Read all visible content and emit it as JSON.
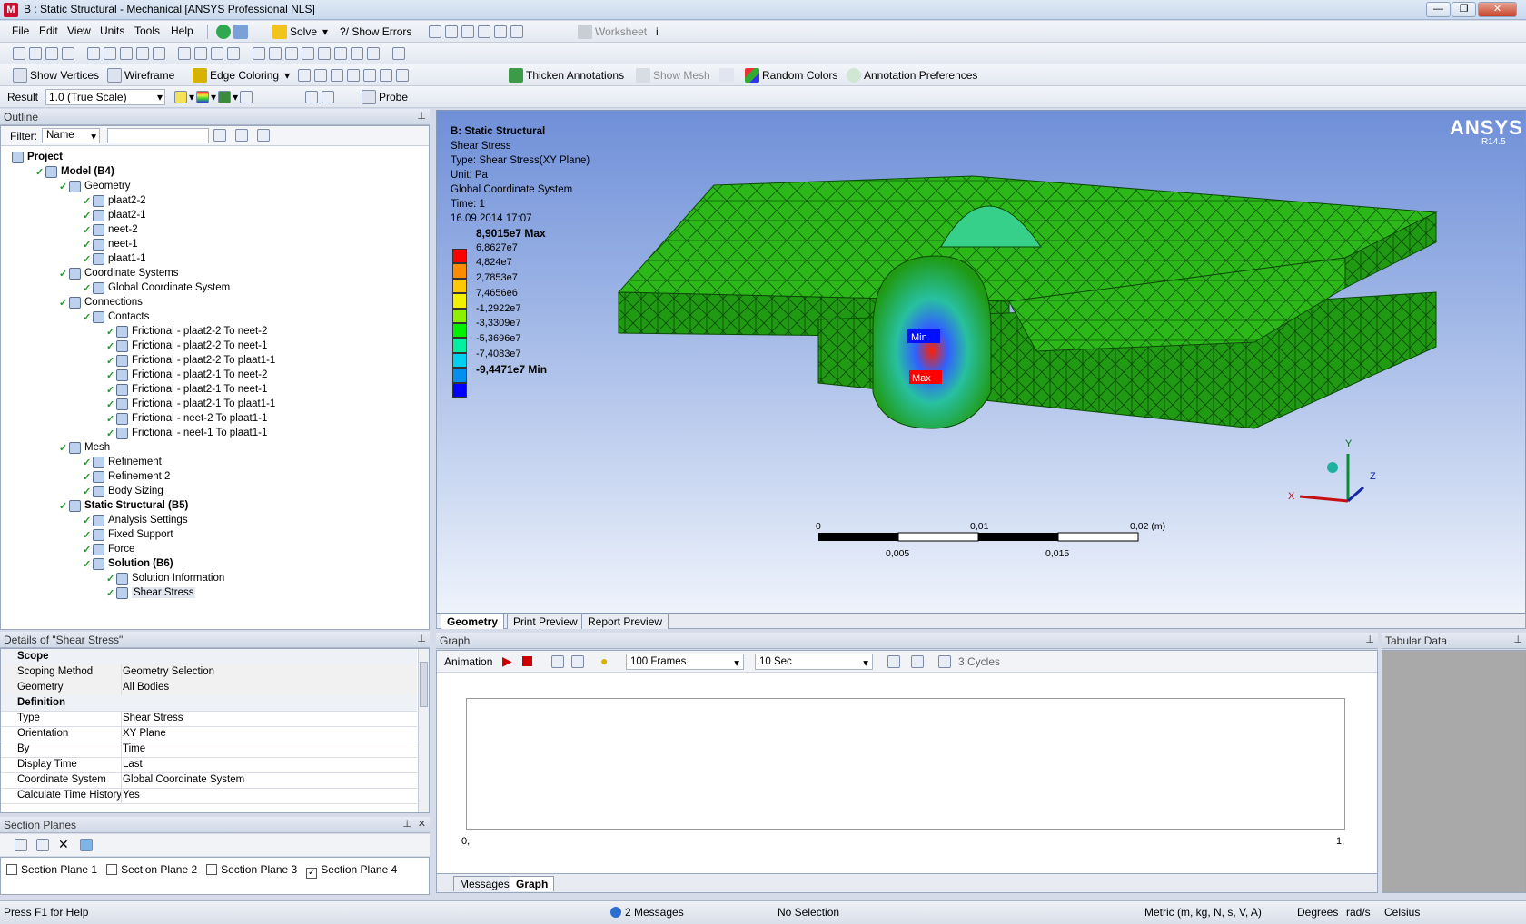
{
  "window": {
    "title": "B : Static Structural - Mechanical [ANSYS Professional NLS]",
    "logo": "M"
  },
  "menu": [
    "File",
    "Edit",
    "View",
    "Units",
    "Tools",
    "Help"
  ],
  "toolbar1": {
    "solve": "Solve",
    "show_errors": "?/ Show Errors",
    "worksheet": "Worksheet"
  },
  "toolbar3": {
    "show_vertices": "Show Vertices",
    "wireframe": "Wireframe",
    "edge_coloring": "Edge Coloring",
    "thicken": "Thicken Annotations",
    "show_mesh": "Show Mesh",
    "random_colors": "Random Colors",
    "annotation_prefs": "Annotation Preferences"
  },
  "toolbar4": {
    "result_label": "Result",
    "result_value": "1.0 (True Scale)",
    "probe": "Probe"
  },
  "outline": {
    "title": "Outline",
    "filter_label": "Filter:",
    "filter_value": "Name",
    "tree": [
      {
        "label": "Project",
        "bold": true,
        "level": 0
      },
      {
        "label": "Model (B4)",
        "bold": true,
        "level": 1
      },
      {
        "label": "Geometry",
        "level": 2
      },
      {
        "label": "plaat2-2",
        "level": 3
      },
      {
        "label": "plaat2-1",
        "level": 3
      },
      {
        "label": "neet-2",
        "level": 3
      },
      {
        "label": "neet-1",
        "level": 3
      },
      {
        "label": "plaat1-1",
        "level": 3
      },
      {
        "label": "Coordinate Systems",
        "level": 2
      },
      {
        "label": "Global Coordinate System",
        "level": 3
      },
      {
        "label": "Connections",
        "level": 2
      },
      {
        "label": "Contacts",
        "level": 3
      },
      {
        "label": "Frictional - plaat2-2 To neet-2",
        "level": 4
      },
      {
        "label": "Frictional - plaat2-2 To neet-1",
        "level": 4
      },
      {
        "label": "Frictional - plaat2-2 To plaat1-1",
        "level": 4
      },
      {
        "label": "Frictional - plaat2-1 To neet-2",
        "level": 4
      },
      {
        "label": "Frictional - plaat2-1 To neet-1",
        "level": 4
      },
      {
        "label": "Frictional - plaat2-1 To plaat1-1",
        "level": 4
      },
      {
        "label": "Frictional - neet-2 To plaat1-1",
        "level": 4
      },
      {
        "label": "Frictional - neet-1 To plaat1-1",
        "level": 4
      },
      {
        "label": "Mesh",
        "level": 2
      },
      {
        "label": "Refinement",
        "level": 3
      },
      {
        "label": "Refinement 2",
        "level": 3
      },
      {
        "label": "Body Sizing",
        "level": 3
      },
      {
        "label": "Static Structural (B5)",
        "bold": true,
        "level": 2
      },
      {
        "label": "Analysis Settings",
        "level": 3
      },
      {
        "label": "Fixed Support",
        "level": 3
      },
      {
        "label": "Force",
        "level": 3
      },
      {
        "label": "Solution (B6)",
        "bold": true,
        "level": 3
      },
      {
        "label": "Solution Information",
        "level": 4
      },
      {
        "label": "Shear Stress",
        "level": 4,
        "selected": true
      }
    ]
  },
  "details": {
    "title": "Details of \"Shear Stress\"",
    "rows": [
      {
        "section": "Scope"
      },
      {
        "k": "Scoping Method",
        "v": "Geometry Selection"
      },
      {
        "k": "Geometry",
        "v": "All Bodies"
      },
      {
        "section": "Definition"
      },
      {
        "k": "Type",
        "v": "Shear Stress"
      },
      {
        "k": "Orientation",
        "v": "XY Plane"
      },
      {
        "k": "By",
        "v": "Time"
      },
      {
        "k": "Display Time",
        "v": "Last"
      },
      {
        "k": "Coordinate System",
        "v": "Global Coordinate System"
      },
      {
        "k": "Calculate Time History",
        "v": "Yes"
      }
    ]
  },
  "section_planes": {
    "title": "Section Planes",
    "items": [
      {
        "label": "Section Plane 1",
        "checked": false
      },
      {
        "label": "Section Plane 2",
        "checked": false
      },
      {
        "label": "Section Plane 3",
        "checked": false
      },
      {
        "label": "Section Plane 4",
        "checked": true
      }
    ]
  },
  "viewport": {
    "brand": "ANSYS",
    "version": "R14.5",
    "info": [
      "B: Static Structural",
      "Shear Stress",
      "Type: Shear Stress(XY Plane)",
      "Unit: Pa",
      "Global Coordinate System",
      "Time: 1",
      "16.09.2014 17:07"
    ],
    "legend": {
      "labels": [
        "8,9015e7 Max",
        "6,8627e7",
        "4,824e7",
        "2,7853e7",
        "7,4656e6",
        "-1,2922e7",
        "-3,3309e7",
        "-5,3696e7",
        "-7,4083e7",
        "-9,4471e7 Min"
      ],
      "colors": [
        "#ff0000",
        "#ff8c00",
        "#ffc800",
        "#f0f000",
        "#8cf000",
        "#00f000",
        "#00f0a0",
        "#00d0f0",
        "#0090f0",
        "#0000ff"
      ]
    },
    "scale": {
      "top": [
        "0",
        "0,01",
        "0,02 (m)"
      ],
      "bottom": [
        "0,005",
        "0,015"
      ]
    },
    "tags": {
      "min": "Min",
      "max": "Max"
    },
    "axes": {
      "x": "X",
      "y": "Y",
      "z": "Z"
    },
    "tabs": [
      "Geometry",
      "Print Preview",
      "Report Preview"
    ]
  },
  "graph": {
    "title": "Graph",
    "animation": "Animation",
    "frames": "100 Frames",
    "duration": "10 Sec",
    "cycles": "3 Cycles",
    "x_min": "0,",
    "x_max": "1,",
    "tabs": [
      "Messages",
      "Graph"
    ]
  },
  "tabular": {
    "title": "Tabular Data"
  },
  "status": {
    "help": "Press F1 for Help",
    "messages": "2 Messages",
    "selection": "No Selection",
    "units": "Metric (m, kg, N, s, V, A)",
    "angle": "Degrees",
    "rot": "rad/s",
    "temp": "Celsius"
  }
}
